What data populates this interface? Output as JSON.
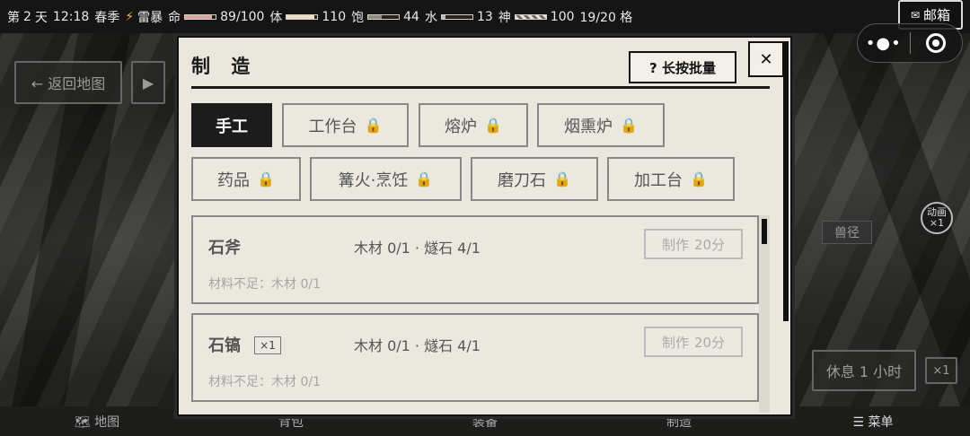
{
  "status": {
    "day_prefix": "第",
    "day": "2",
    "day_suffix": "天",
    "time": "12:18",
    "season": "春季",
    "weather_icon": "⚡",
    "weather": "雷暴",
    "life_label": "命",
    "life_value": "89/100",
    "life_fraction": 0.89,
    "stamina_label": "体",
    "stamina_value": "110",
    "stamina_fraction": 0.9,
    "hunger_label": "饱",
    "hunger_value": "44",
    "hunger_fraction": 0.44,
    "water_label": "水",
    "water_value": "13",
    "water_fraction": 0.13,
    "spirit_label": "神",
    "spirit_value": "100",
    "spirit_fraction": 1.0,
    "slots": "19/20 格"
  },
  "header_right": {
    "mail_icon": "✉",
    "mail_label": "邮箱",
    "capsule_more": "•●•",
    "capsule_close_icon": "target-icon"
  },
  "background": {
    "back_label": "← 返回地图",
    "play_icon": "▶",
    "trail_label": "兽径",
    "anim_label": "动画",
    "anim_speed": "×1",
    "rest_label": "休息 1 小时",
    "rest_speed": "×1"
  },
  "bottom_nav": [
    {
      "label": "🗺 地图"
    },
    {
      "label": "背包"
    },
    {
      "label": "装备"
    },
    {
      "label": "制造"
    },
    {
      "label": "☰ 菜单"
    }
  ],
  "modal": {
    "title": "制 造",
    "help_label": "? 长按批量",
    "close_icon": "✕",
    "lock_icon": "🔒",
    "tabs_row1": [
      {
        "label": "手工",
        "active": true,
        "locked": false
      },
      {
        "label": "工作台",
        "active": false,
        "locked": true
      },
      {
        "label": "熔炉",
        "active": false,
        "locked": true
      },
      {
        "label": "烟熏炉",
        "active": false,
        "locked": true
      }
    ],
    "tabs_row2": [
      {
        "label": "药品",
        "locked": true
      },
      {
        "label": "篝火·烹饪",
        "locked": true
      },
      {
        "label": "磨刀石",
        "locked": true
      },
      {
        "label": "加工台",
        "locked": true
      }
    ],
    "recipes": [
      {
        "name": "石斧",
        "qty_badge": "",
        "materials": "木材 0/1 · 燧石 4/1",
        "craft_label": "制作",
        "craft_time": "20分",
        "warning": "材料不足：木材 0/1"
      },
      {
        "name": "石镐",
        "qty_badge": "×1",
        "materials": "木材 0/1 · 燧石 4/1",
        "craft_label": "制作",
        "craft_time": "20分",
        "warning": "材料不足：木材 0/1"
      }
    ]
  }
}
